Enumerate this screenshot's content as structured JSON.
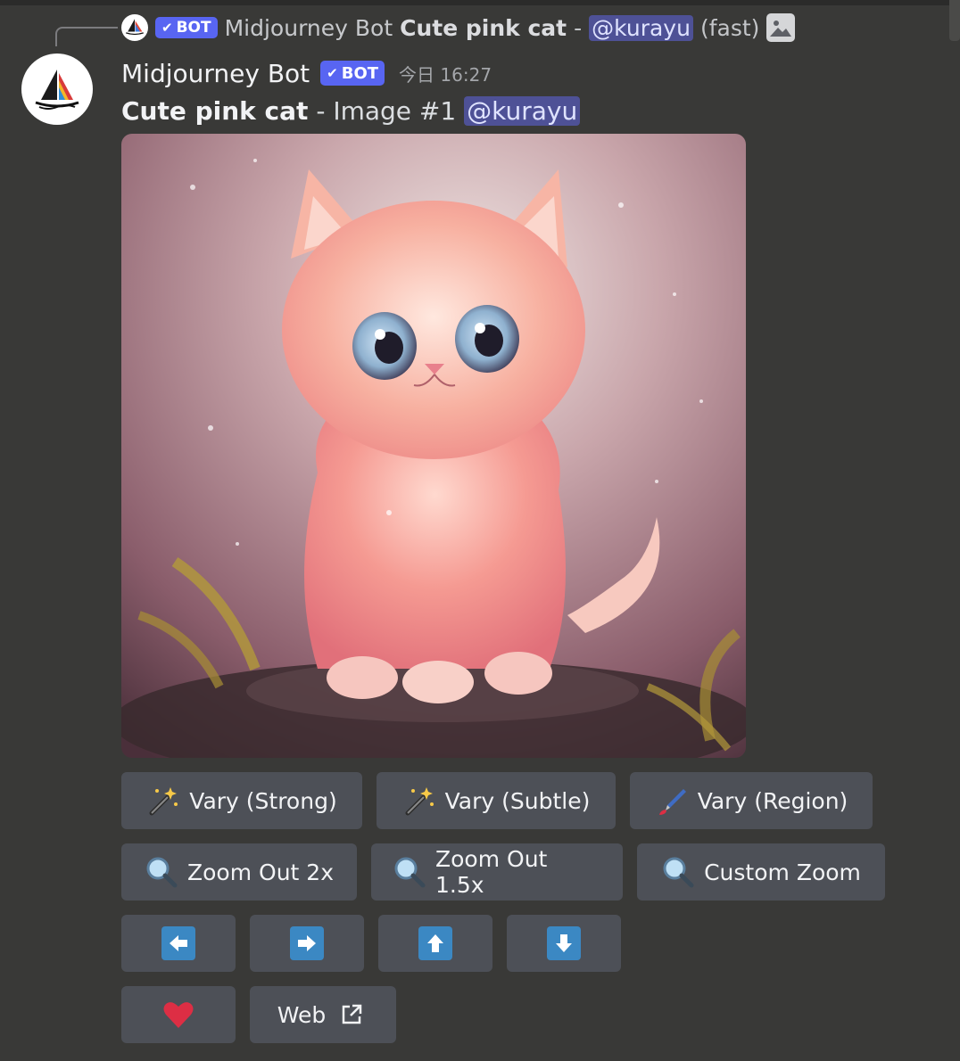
{
  "reply": {
    "author": "Midjourney Bot",
    "bot_badge": "BOT",
    "title": "Cute pink cat",
    "separator": "-",
    "mention": "@kurayu",
    "speed": "(fast)",
    "attachment_icon": "image-icon"
  },
  "message": {
    "author": "Midjourney Bot",
    "bot_badge": "BOT",
    "timestamp": "今日 16:27",
    "title": "Cute pink cat",
    "image_label": " - Image #1 ",
    "mention": "@kurayu",
    "image_alt": "Cute pink cat"
  },
  "buttons": {
    "row1": [
      {
        "label": "Vary (Strong)",
        "icon": "magic-wand-icon"
      },
      {
        "label": "Vary (Subtle)",
        "icon": "magic-wand-icon"
      },
      {
        "label": "Vary (Region)",
        "icon": "paintbrush-icon"
      }
    ],
    "row2": [
      {
        "label": "Zoom Out 2x",
        "icon": "magnifier-icon"
      },
      {
        "label": "Zoom Out 1.5x",
        "icon": "magnifier-icon"
      },
      {
        "label": "Custom Zoom",
        "icon": "magnifier-icon"
      }
    ],
    "row3": [
      {
        "icon": "arrow-left-icon"
      },
      {
        "icon": "arrow-right-icon"
      },
      {
        "icon": "arrow-up-icon"
      },
      {
        "icon": "arrow-down-icon"
      }
    ],
    "row4": [
      {
        "icon": "heart-icon"
      },
      {
        "label": "Web",
        "icon": "external-link-icon"
      }
    ]
  },
  "colors": {
    "background": "#393937",
    "button": "#4d5057",
    "bot_badge": "#5865f2",
    "mention": "#4e5196",
    "arrow_button": "#3b88c3",
    "heart": "#dd2e44"
  }
}
